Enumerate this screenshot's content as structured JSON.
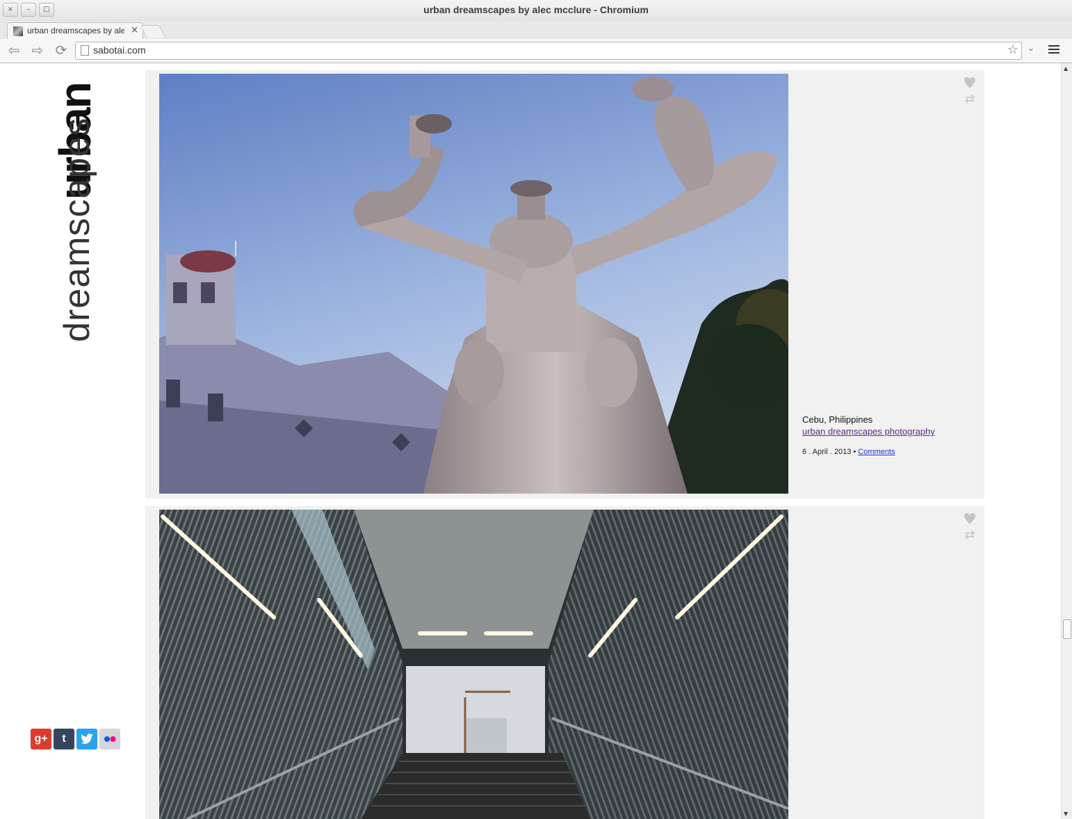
{
  "window": {
    "title": "urban dreamscapes by alec mcclure - Chromium",
    "buttons": [
      "×",
      "–",
      "□"
    ]
  },
  "tab": {
    "title": "urban dreamscapes by ale",
    "close": "×"
  },
  "toolbar": {
    "back": "⇦",
    "forward": "⇨",
    "reload": "⟳",
    "url": "sabotai.com",
    "star": "☆",
    "dropdown": "⌄"
  },
  "logo": {
    "line1": "urban",
    "line2": "dreamscapes"
  },
  "social": {
    "items": [
      {
        "icon": "google-plus-icon",
        "label": "g+",
        "color": "#dd3b2b"
      },
      {
        "icon": "tumblr-icon",
        "label": "t",
        "color": "#35465c"
      },
      {
        "icon": "twitter-icon",
        "label": "🐦",
        "color": "#2aa3ef"
      },
      {
        "icon": "flickr-icon",
        "label": "●●",
        "color": "#b8b8c8"
      }
    ]
  },
  "posts": [
    {
      "place": "Cebu, Philippines",
      "link": "urban dreamscapes photography ",
      "date": "6 . April . 2013 • ",
      "comments": "Comments",
      "heart": "♥",
      "reblog": "⇄"
    },
    {
      "heart": "♥",
      "reblog": "⇄"
    }
  ],
  "colors": {
    "post_bg": "#f1f1f1",
    "link": "#5b2a8a",
    "comments_link": "#1a33cc"
  }
}
